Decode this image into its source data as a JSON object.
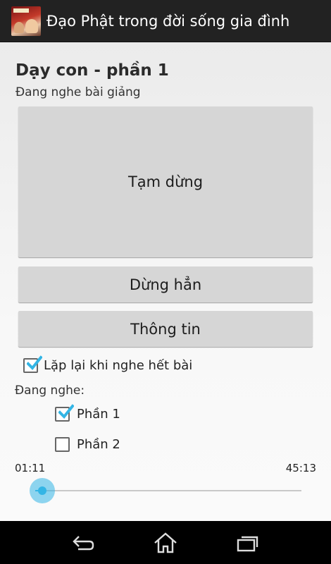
{
  "app": {
    "title": "Đạo Phật trong đời sống gia đình",
    "icon": "app-logo-icon"
  },
  "lesson": {
    "title": "Dạy con - phần 1",
    "status": "Đang nghe bài giảng"
  },
  "buttons": {
    "pause": "Tạm dừng",
    "stop": "Dừng hẳn",
    "info": "Thông tin"
  },
  "repeat": {
    "label": "Lặp lại khi nghe hết bài",
    "checked": true
  },
  "parts": {
    "heading": "Đang nghe:",
    "items": [
      {
        "label": "Phần 1",
        "checked": true
      },
      {
        "label": "Phần 2",
        "checked": false
      }
    ]
  },
  "player": {
    "current_time": "01:11",
    "total_time": "45:13",
    "progress": 0.026
  },
  "navbar": {
    "back_icon": "back-icon",
    "home_icon": "home-icon",
    "recents_icon": "recents-icon"
  },
  "colors": {
    "accent": "#33b5e5",
    "actionbar": "#222222",
    "button": "#d6d6d6"
  }
}
